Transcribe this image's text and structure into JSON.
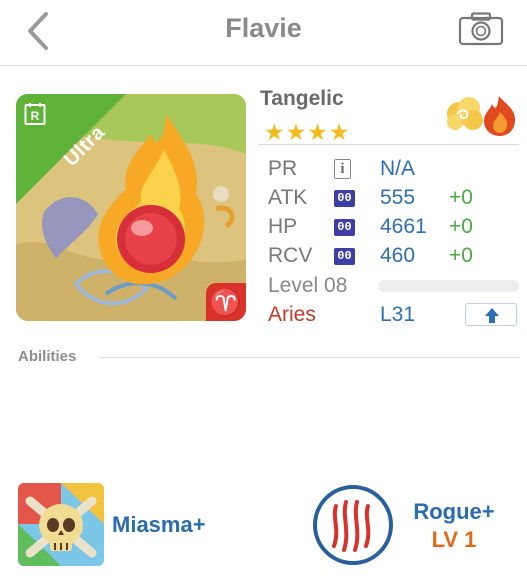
{
  "header": {
    "title": "Flavie",
    "back_icon": "chevron-left-icon",
    "camera_icon": "camera-icon"
  },
  "monster": {
    "name": "Tangelic",
    "rarity": "Ultra",
    "rarity_icon": "r-badge-icon",
    "stars": "★★★★",
    "star_count": 4,
    "elements": [
      "cloud-element-icon",
      "fire-element-icon"
    ],
    "zodiac_symbol": "♈"
  },
  "stats": {
    "pr": {
      "label": "PR",
      "badge": "i",
      "value": "N/A"
    },
    "atk": {
      "label": "ATK",
      "badge": "00",
      "value": "555",
      "bonus": "+0"
    },
    "hp": {
      "label": "HP",
      "badge": "00",
      "value": "4661",
      "bonus": "+0"
    },
    "rcv": {
      "label": "RCV",
      "badge": "00",
      "value": "460",
      "bonus": "+0"
    }
  },
  "level": {
    "label": "Level 08",
    "progress": 0
  },
  "zodiac": {
    "name": "Aries",
    "level": "L31",
    "upgrade_icon": "arrow-up-icon"
  },
  "abilities": {
    "section_label": "Abilities",
    "ability": {
      "name": "Miasma+",
      "icon": "poison-skull-icon"
    },
    "class": {
      "name": "Rogue+",
      "level": "LV 1",
      "icon": "claw-marks-icon"
    }
  },
  "colors": {
    "accent_blue": "#2e6fb4",
    "bonus_green": "#4aa840",
    "zodiac_red": "#c23a2b",
    "class_level_orange": "#e06a1a",
    "star_gold": "#f2bb1b",
    "ribbon_green": "#5fb339"
  }
}
